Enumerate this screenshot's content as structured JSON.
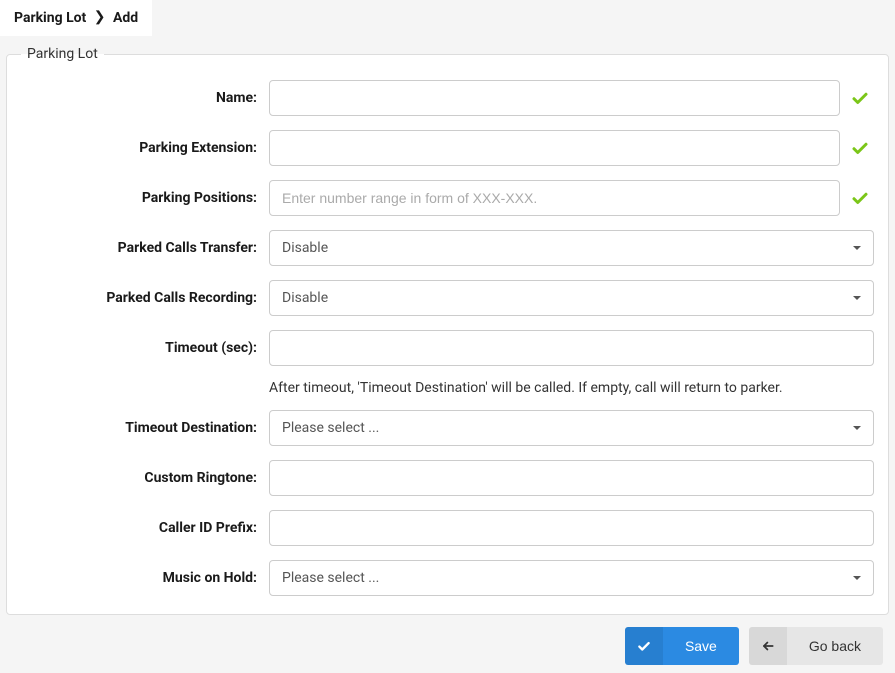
{
  "breadcrumb": {
    "parent": "Parking Lot",
    "current": "Add"
  },
  "fieldset": {
    "legend": "Parking Lot"
  },
  "form": {
    "name": {
      "label": "Name:",
      "value": ""
    },
    "parking_extension": {
      "label": "Parking Extension:",
      "value": ""
    },
    "parking_positions": {
      "label": "Parking Positions:",
      "placeholder": "Enter number range in form of XXX-XXX.",
      "value": ""
    },
    "parked_calls_transfer": {
      "label": "Parked Calls Transfer:",
      "value": "Disable"
    },
    "parked_calls_recording": {
      "label": "Parked Calls Recording:",
      "value": "Disable"
    },
    "timeout_sec": {
      "label": "Timeout (sec):",
      "value": ""
    },
    "timeout_helper": "After timeout, 'Timeout Destination' will be called. If empty, call will return to parker.",
    "timeout_destination": {
      "label": "Timeout Destination:",
      "value": "Please select ..."
    },
    "custom_ringtone": {
      "label": "Custom Ringtone:",
      "value": ""
    },
    "caller_id_prefix": {
      "label": "Caller ID Prefix:",
      "value": ""
    },
    "music_on_hold": {
      "label": "Music on Hold:",
      "value": "Please select ..."
    }
  },
  "actions": {
    "save": "Save",
    "go_back": "Go back"
  },
  "colors": {
    "primary": "#2b8ae2",
    "success": "#7bc618"
  }
}
